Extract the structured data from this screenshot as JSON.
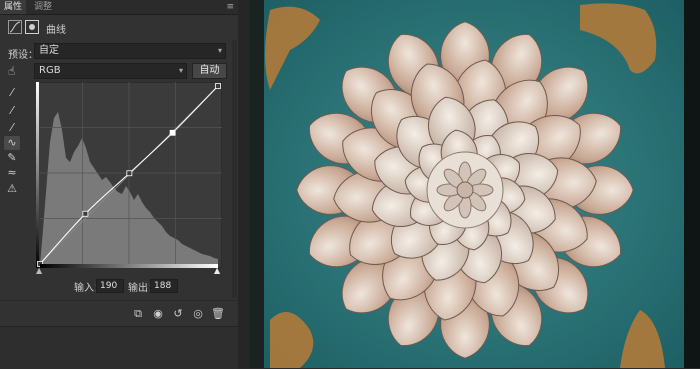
{
  "tabs": {
    "properties": "属性",
    "adjustments": "调整"
  },
  "panel": {
    "title": "曲线"
  },
  "preset": {
    "label": "预设：",
    "value": "自定"
  },
  "channel": {
    "value": "RGB",
    "auto_label": "自动"
  },
  "readout": {
    "input_label": "输入：",
    "input_value": "190",
    "output_label": "输出：",
    "output_value": "188"
  },
  "curve_points": [
    [
      0,
      0
    ],
    [
      65,
      72
    ],
    [
      128,
      130
    ],
    [
      190,
      188
    ],
    [
      255,
      255
    ]
  ],
  "icons": {
    "tools": [
      "on-image-adjust-icon",
      "eyedropper-black-icon",
      "eyedropper-gray-icon",
      "eyedropper-white-icon",
      "curve-points-icon",
      "pencil-icon",
      "smooth-icon",
      "clipping-warning-icon"
    ],
    "footer": [
      "clip-to-layer-icon",
      "view-previous-icon",
      "reset-icon",
      "visibility-eye-icon",
      "delete-icon"
    ]
  },
  "colors": {
    "panel_bg": "#323232",
    "histogram": "#7a7a7a",
    "curve": "#ffffff"
  }
}
